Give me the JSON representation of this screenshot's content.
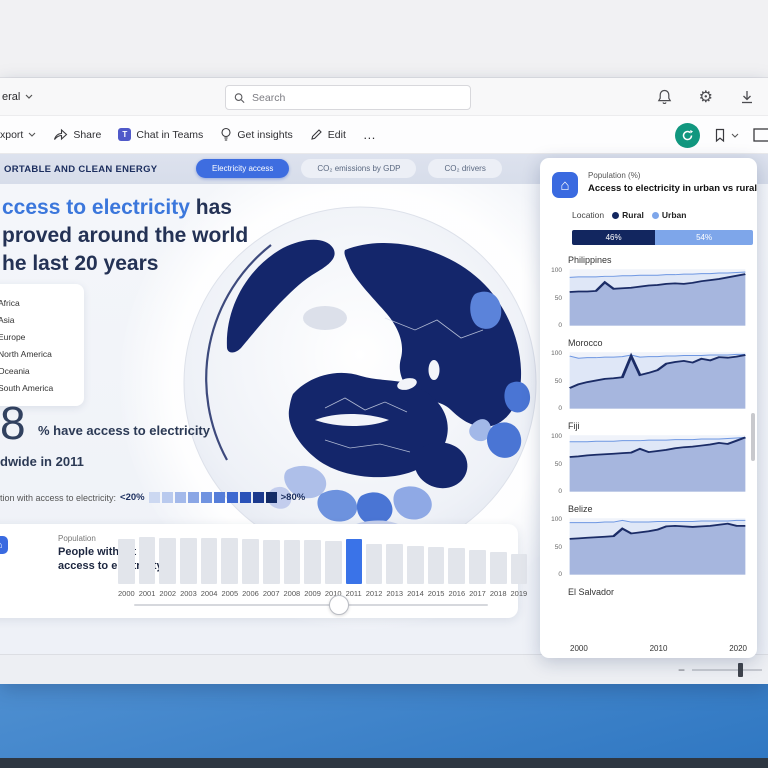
{
  "chrome": {
    "nav_label": "eral",
    "search_placeholder": "Search",
    "toolbar": {
      "export": "xport",
      "share": "Share",
      "chat": "Chat in Teams",
      "insights": "Get insights",
      "edit": "Edit",
      "more": "…"
    }
  },
  "band": {
    "report_title": "ORTABLE AND CLEAN ENERGY",
    "tabs": [
      {
        "label": "Electricity access",
        "active": true
      },
      {
        "label": "CO₂ emissions by GDP",
        "active": false
      },
      {
        "label": "CO₂ drivers",
        "active": false
      }
    ]
  },
  "main": {
    "headline": {
      "accent": "ccess to electricity",
      "rest": " has",
      "line2": "proved around the world",
      "line3": "he last 20 years"
    },
    "continents": [
      "Africa",
      "Asia",
      "Europe",
      "North America",
      "Oceania",
      "South America"
    ],
    "stat": {
      "big": "8",
      "label": "% have access to electricity",
      "sub": "dwide in 2011"
    },
    "scale": {
      "label": "tion with access to electricity:",
      "min": "<20%",
      "max": ">80%",
      "swatches": [
        "#ccd8f1",
        "#b9caee",
        "#a3b9ea",
        "#8aa6e5",
        "#7093e0",
        "#567ed9",
        "#3d68d0",
        "#2a52b8",
        "#1c3a8e",
        "#122a66"
      ]
    },
    "timeline_header": {
      "kicker": "Population",
      "title_line1": "People without",
      "title_line2": "access to electricity"
    }
  },
  "panel": {
    "subtitle": "Population (%)",
    "title": "Access to electricity in urban vs rural areas",
    "legend": {
      "label": "Location",
      "items": [
        {
          "name": "Rural",
          "color": "#12265f"
        },
        {
          "name": "Urban",
          "color": "#7ea6ea"
        }
      ]
    },
    "x_ticks": [
      "2000",
      "2010",
      "2020"
    ]
  },
  "chart_data": {
    "timeline": {
      "type": "bar",
      "title": "People without access to electricity",
      "categories": [
        "2000",
        "2001",
        "2002",
        "2003",
        "2004",
        "2005",
        "2006",
        "2007",
        "2008",
        "2009",
        "2010",
        "2011",
        "2012",
        "2013",
        "2014",
        "2015",
        "2016",
        "2017",
        "2018",
        "2019"
      ],
      "values": [
        86,
        90,
        88,
        88,
        89,
        88,
        87,
        85,
        84,
        84,
        83,
        86,
        77,
        76,
        74,
        72,
        70,
        66,
        62,
        57
      ],
      "highlight_year": "2011",
      "bar_color": "#e2e5eb",
      "highlight_color": "#3a73e8"
    },
    "rural_urban_split": {
      "type": "bar-stacked",
      "title": "Access to electricity in urban vs rural areas",
      "series": [
        {
          "name": "Rural",
          "value": 46,
          "label": "46%",
          "color": "#12265f"
        },
        {
          "name": "Urban",
          "value": 54,
          "label": "54%",
          "color": "#7ea6ea"
        }
      ]
    },
    "small_multiples": [
      {
        "name": "Philippines",
        "type": "area",
        "x_range": [
          2000,
          2020
        ],
        "yticks": [
          0,
          50,
          100
        ],
        "series": [
          {
            "name": "Urban",
            "color": "#6e97e2",
            "fill": "#dfe7f7",
            "values": [
              89,
              90,
              90,
              90,
              91,
              91,
              92,
              92,
              93,
              93,
              93,
              94,
              94,
              95,
              95,
              96,
              96,
              97,
              97,
              98,
              99
            ]
          },
          {
            "name": "Rural",
            "color": "#1b2c66",
            "fill": "rgba(147,166,214,0.75)",
            "values": [
              62,
              63,
              63,
              64,
              80,
              68,
              69,
              70,
              72,
              74,
              75,
              77,
              78,
              77,
              79,
              82,
              84,
              86,
              89,
              92,
              95
            ]
          }
        ]
      },
      {
        "name": "Morocco",
        "type": "area",
        "x_range": [
          2000,
          2020
        ],
        "yticks": [
          0,
          50,
          100
        ],
        "series": [
          {
            "name": "Urban",
            "color": "#6e97e2",
            "fill": "#dfe7f7",
            "values": [
              97,
              93,
              94,
              94,
              95,
              95,
              96,
              99,
              95,
              96,
              96,
              97,
              97,
              98,
              98,
              98,
              99,
              99,
              99,
              100,
              100
            ]
          },
          {
            "name": "Rural",
            "color": "#1b2c66",
            "fill": "rgba(147,166,214,0.75)",
            "values": [
              38,
              45,
              49,
              52,
              55,
              56,
              58,
              97,
              62,
              66,
              71,
              83,
              86,
              88,
              85,
              92,
              89,
              95,
              94,
              96,
              99
            ]
          }
        ]
      },
      {
        "name": "Fiji",
        "type": "area",
        "x_range": [
          2000,
          2020
        ],
        "yticks": [
          0,
          50,
          100
        ],
        "series": [
          {
            "name": "Urban",
            "color": "#6e97e2",
            "fill": "#dfe7f7",
            "values": [
              92,
              92,
              92,
              93,
              93,
              93,
              94,
              94,
              94,
              95,
              95,
              95,
              96,
              96,
              96,
              97,
              97,
              97,
              98,
              99,
              100
            ]
          },
          {
            "name": "Rural",
            "color": "#1b2c66",
            "fill": "rgba(147,166,214,0.75)",
            "values": [
              64,
              65,
              67,
              68,
              69,
              70,
              71,
              72,
              79,
              73,
              75,
              77,
              80,
              82,
              83,
              85,
              87,
              90,
              88,
              94,
              100
            ]
          }
        ]
      },
      {
        "name": "Belize",
        "type": "area",
        "x_range": [
          2000,
          2020
        ],
        "yticks": [
          0,
          50,
          100
        ],
        "series": [
          {
            "name": "Urban",
            "color": "#6e97e2",
            "fill": "#dfe7f7",
            "values": [
              96,
              96,
              96,
              96,
              97,
              97,
              100,
              97,
              97,
              97,
              98,
              98,
              98,
              98,
              98,
              99,
              99,
              99,
              99,
              100,
              100
            ]
          },
          {
            "name": "Rural",
            "color": "#1b2c66",
            "fill": "rgba(147,166,214,0.75)",
            "values": [
              66,
              67,
              68,
              69,
              70,
              71,
              85,
              76,
              78,
              80,
              83,
              89,
              90,
              89,
              88,
              89,
              90,
              92,
              94,
              90,
              90
            ]
          }
        ]
      },
      {
        "name": "El Salvador",
        "type": "area",
        "clipped": true
      }
    ]
  }
}
